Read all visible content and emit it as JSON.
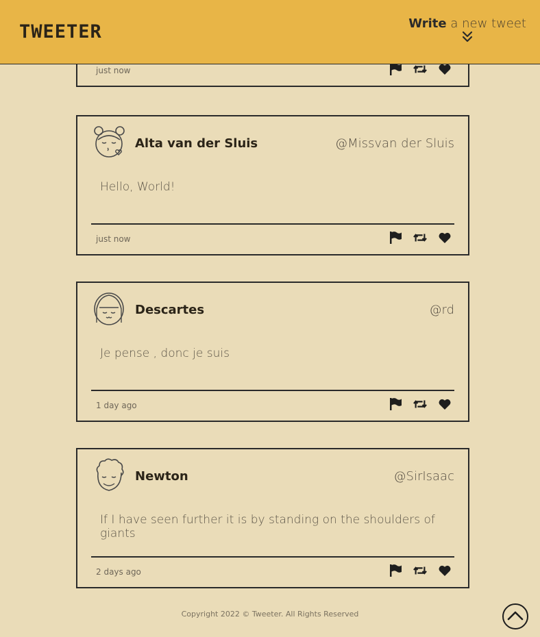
{
  "header": {
    "logo": "TWEETER",
    "write_bold": "Write",
    "write_rest": " a new tweet",
    "write_icon": "double-chevron-down-icon"
  },
  "tweets": [
    {
      "name": "",
      "handle": "",
      "text": "",
      "time": "just now",
      "avatar": "partial-tweet"
    },
    {
      "name": "Alta van der Sluis",
      "handle": "@Missvan der Sluis",
      "text": "Hello, World!",
      "time": "just now",
      "avatar": "girl-buns-kiss-avatar"
    },
    {
      "name": "Descartes",
      "handle": "@rd",
      "text": "Je pense , donc je suis",
      "time": "1 day ago",
      "avatar": "girl-bangs-avatar"
    },
    {
      "name": "Newton",
      "handle": "@SirIsaac",
      "text": "If I have seen further it is by standing on the shoulders of giants",
      "time": "2 days ago",
      "avatar": "curly-hair-avatar"
    }
  ],
  "actions": {
    "flag": "flag-icon",
    "retweet": "retweet-icon",
    "like": "heart-icon"
  },
  "footer": {
    "copyright": "Copyright 2022 © Tweeter. All Rights Reserved"
  },
  "scroll_top_icon": "chevron-up-circle-icon",
  "colors": {
    "header_bg": "#e8b547",
    "page_bg": "#eadcb8",
    "border": "#2a2a2a"
  }
}
